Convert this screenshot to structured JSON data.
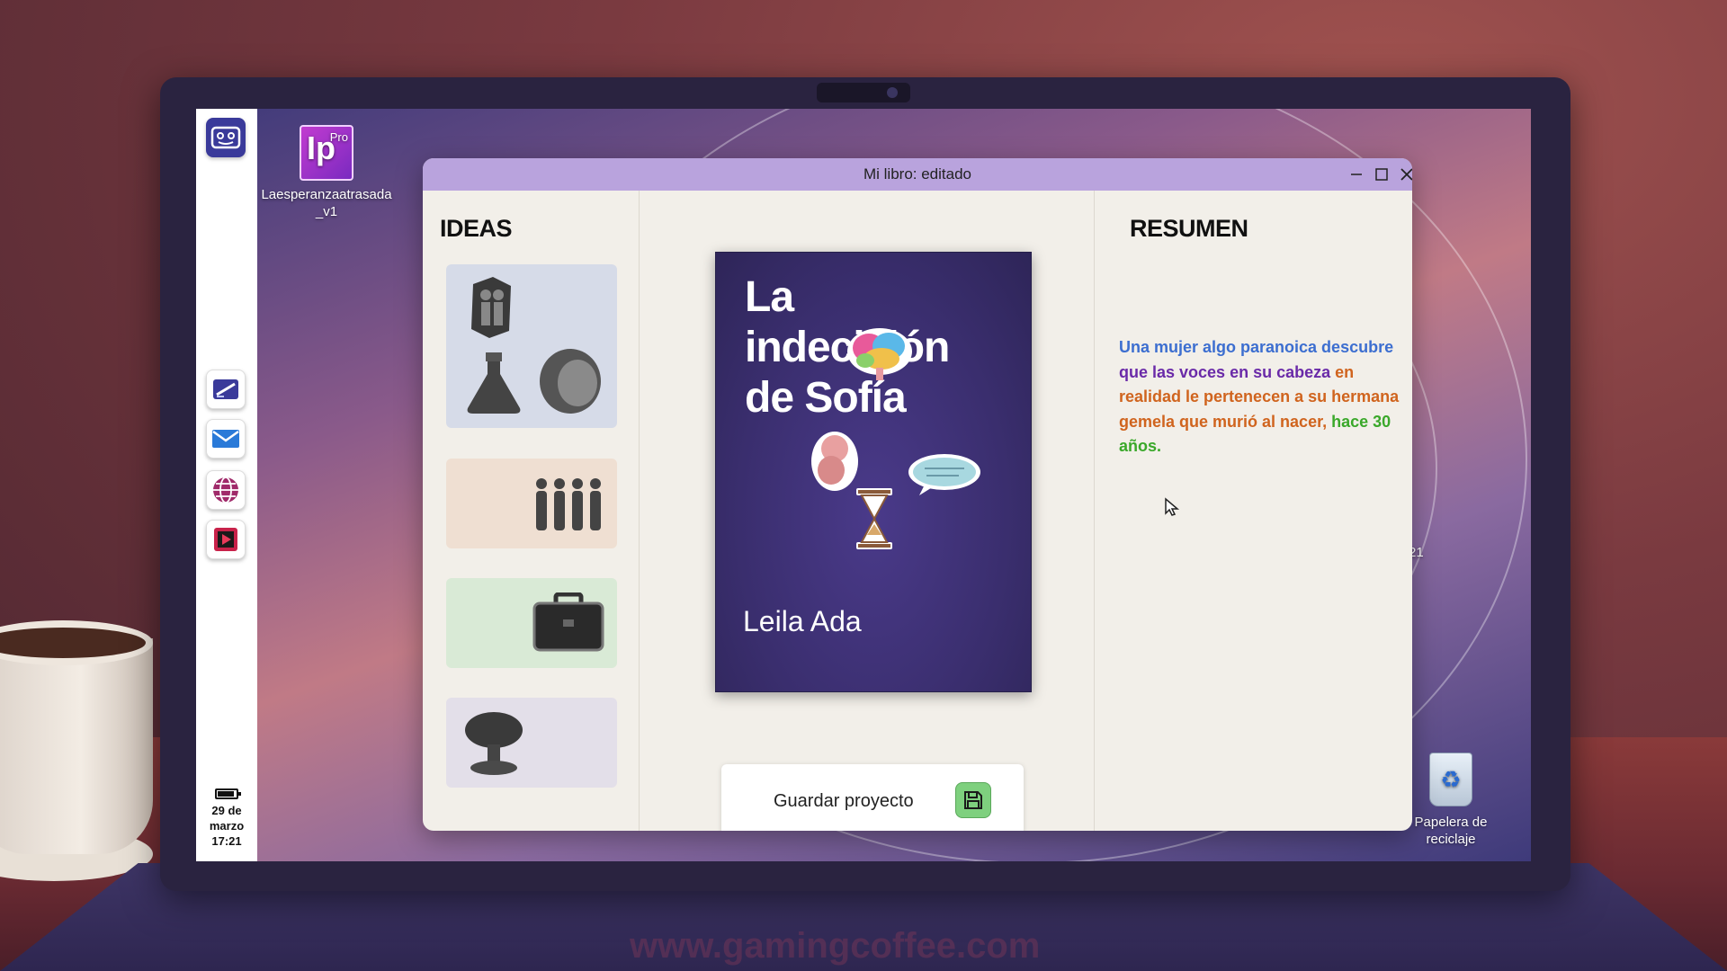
{
  "desktop": {
    "app_icon": {
      "pro_badge": "Pro",
      "logo_text": "Ip",
      "label": "Laesperanzaatrasada_v1"
    },
    "recycle_bin": {
      "label": "Papelera de reciclaje"
    },
    "partial_label": "21"
  },
  "taskbar": {
    "apps": [
      "logo-app",
      "drawing-app",
      "mail-app",
      "browser-app",
      "video-app"
    ],
    "clock": {
      "date_line1": "29 de",
      "date_line2": "marzo",
      "time": "17:21"
    }
  },
  "window": {
    "title": "Mi libro: editado",
    "controls": {
      "minimize": "—",
      "maximize": "☐",
      "close": "✕"
    },
    "ideas": {
      "title": "IDEAS",
      "cards": [
        {
          "bg": "#d6dbe8",
          "icons": [
            "couple-icon",
            "flask-icon",
            "woman-head-icon"
          ]
        },
        {
          "bg": "#efdfd2",
          "icons": [
            "family-icon"
          ]
        },
        {
          "bg": "#d9ead6",
          "icons": [
            "briefcase-icon"
          ]
        },
        {
          "bg": "#e3dfe9",
          "icons": [
            "mushroom-cloud-icon"
          ]
        }
      ]
    },
    "book": {
      "title_line1": "La",
      "title_line2": "indecisión",
      "title_line3": "de Sofía",
      "author": "Leila Ada",
      "stickers": [
        "brain-icon",
        "fetus-icon",
        "speech-bubble-icon",
        "hourglass-icon"
      ]
    },
    "save": {
      "label": "Guardar proyecto",
      "icon": "floppy-disk-icon"
    },
    "summary": {
      "title": "RESUMEN",
      "segments": [
        {
          "text": "Una mujer algo paranoica descubre",
          "color": "#3c6ed0"
        },
        {
          "text": " que las voces en su cabeza",
          "color": "#6a2aa8"
        },
        {
          "text": " en realidad le pertenecen a su hermana gemela que murió al nacer,",
          "color": "#d0641e"
        },
        {
          "text": " hace 30 años.",
          "color": "#3aa82a"
        }
      ]
    }
  },
  "watermark": "www.gamingcoffee.com"
}
